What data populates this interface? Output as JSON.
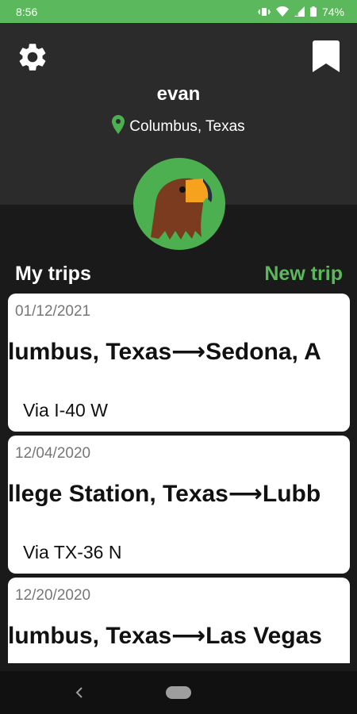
{
  "status_bar": {
    "time": "8:56",
    "battery": "74%",
    "icons": [
      "vibrate-icon",
      "wifi-icon",
      "signal-icon",
      "battery-icon"
    ]
  },
  "header": {
    "settings_icon": "gear-icon",
    "bookmark_icon": "bookmark-icon",
    "username": "evan",
    "location": "Columbus, Texas",
    "avatar_icon": "eagle-avatar-icon"
  },
  "trips_section": {
    "title": "My trips",
    "new_trip_label": "New trip"
  },
  "trips": [
    {
      "date": "01/12/2021",
      "route": "lumbus, Texas⟶Sedona, A",
      "via": "Via I-40 W"
    },
    {
      "date": "12/04/2020",
      "route": "llege Station, Texas⟶Lubb",
      "via": "Via TX-36 N"
    },
    {
      "date": "12/20/2020",
      "route": "lumbus, Texas⟶Las Vegas",
      "via": ""
    }
  ],
  "nav_bar": {
    "back_icon": "back-chevron-icon",
    "home_icon": "home-pill-icon"
  },
  "colors": {
    "accent": "#5cb85c",
    "header_bg": "#2b2b2b",
    "page_bg": "#1a1a1a",
    "card_bg": "#ffffff"
  }
}
